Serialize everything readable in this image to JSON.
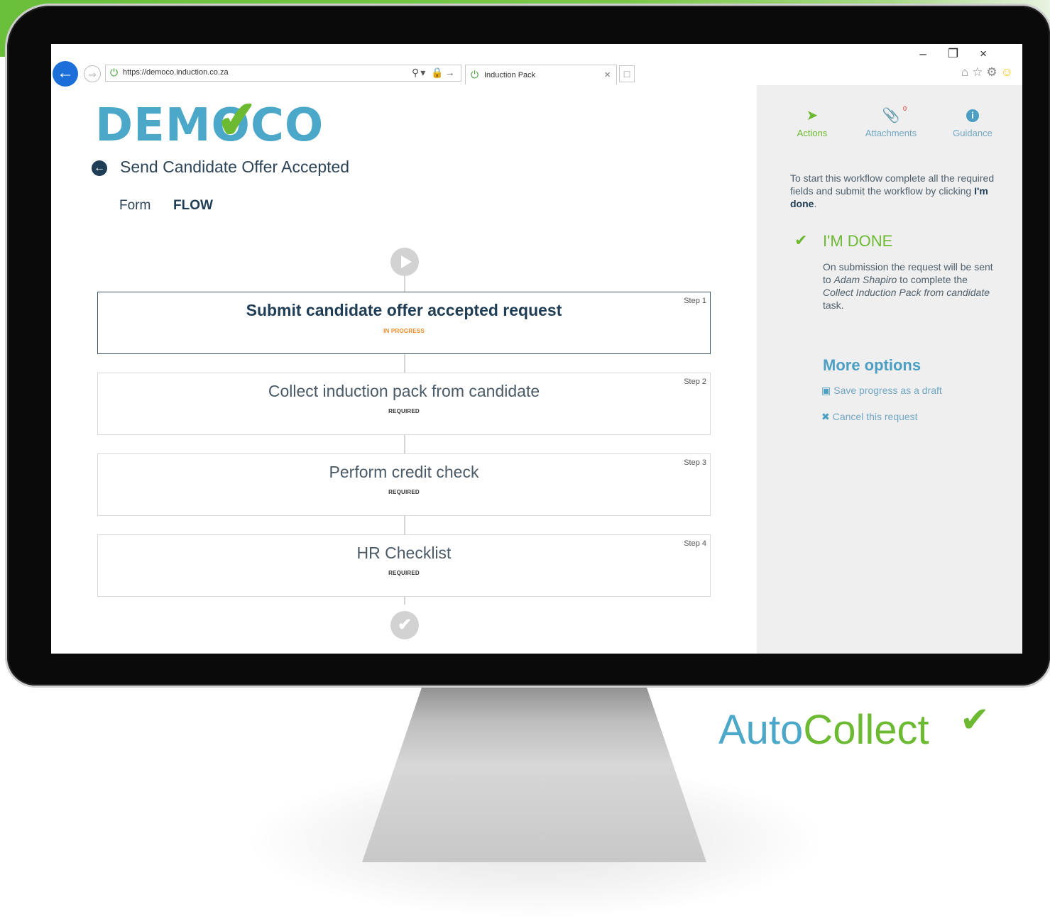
{
  "browser": {
    "url": "https://democo.induction.co.za",
    "tab_title": "Induction Pack"
  },
  "logo": {
    "text": "DEMOCO"
  },
  "header": {
    "title": "Send Candidate Offer Accepted",
    "tabs": {
      "form": "Form",
      "flow": "FLOW"
    }
  },
  "flow": {
    "steps": [
      {
        "number": "Step 1",
        "title": "Submit candidate offer accepted request",
        "status": "IN PROGRESS"
      },
      {
        "number": "Step 2",
        "title": "Collect induction pack from candidate",
        "status": "REQUIRED"
      },
      {
        "number": "Step 3",
        "title": "Perform credit check",
        "status": "REQUIRED"
      },
      {
        "number": "Step 4",
        "title": "HR Checklist",
        "status": "REQUIRED"
      }
    ]
  },
  "panel": {
    "tabs": {
      "actions": "Actions",
      "attachments": "Attachments",
      "guidance": "Guidance"
    },
    "attachments_count": "0",
    "intro_pre": "To start this workflow complete all the required fields and submit the workflow by clicking ",
    "intro_bold": "I'm done",
    "intro_post": ".",
    "done_label": "I'M DONE",
    "done_desc": {
      "part1": "On submission the request will be sent to ",
      "person": "Adam Shapiro",
      "part2": " to complete the ",
      "task": "Collect Induction Pack from candidate",
      "part3": " task."
    },
    "more_options_title": "More options",
    "save_draft": "Save progress as a draft",
    "cancel_request": "Cancel this request"
  },
  "brand": {
    "auto": "Auto",
    "collect": "Collect"
  },
  "colors": {
    "green": "#6cb932",
    "blue": "#4b9fc3",
    "navy": "#1f3d55",
    "orange": "#f08a24"
  }
}
